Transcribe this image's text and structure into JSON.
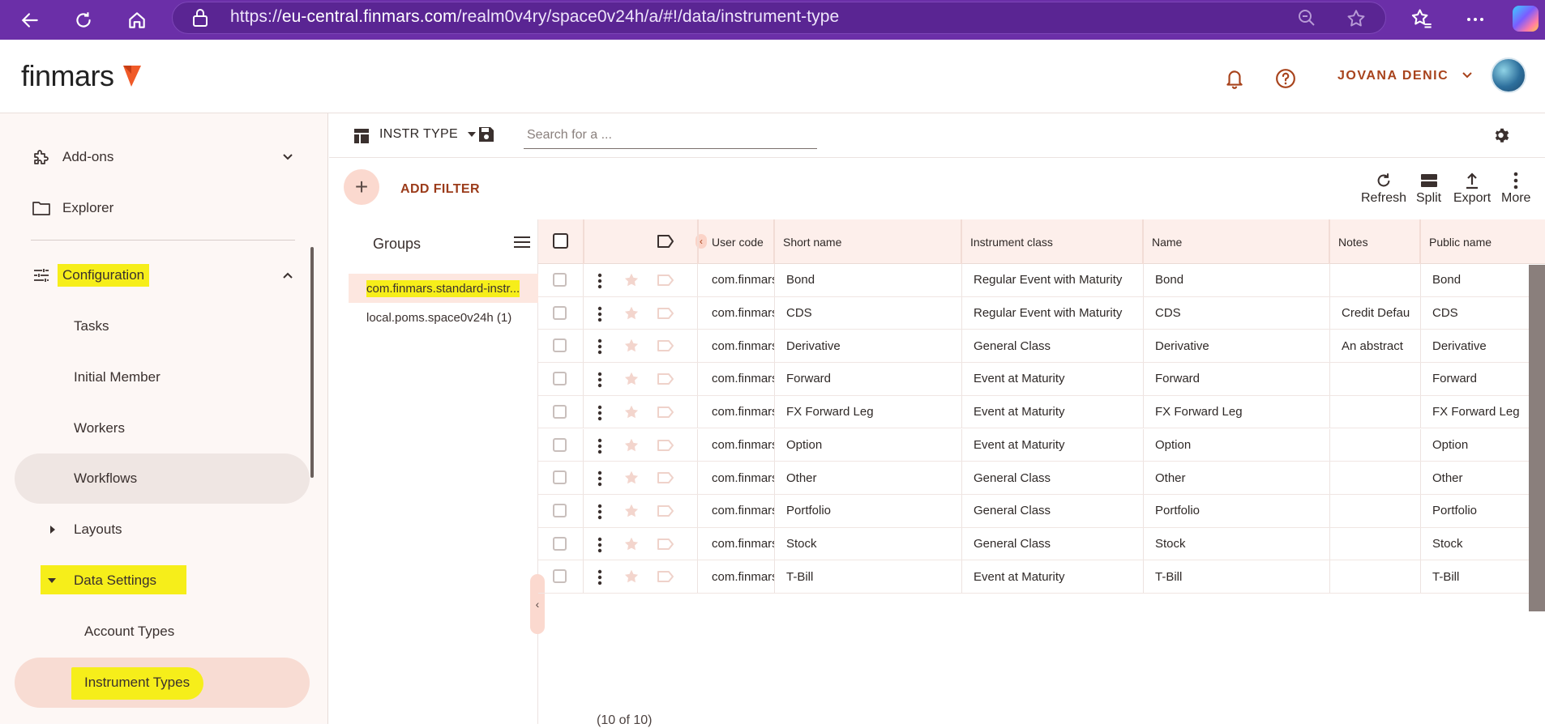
{
  "browser": {
    "url_prefix": "https://",
    "url_host": "eu-central.finmars.com",
    "url_path": "/realm0v4ry/space0v24h/a/#!/data/instrument-type"
  },
  "header": {
    "logo_text": "finmars",
    "user_name": "JOVANA DENIC"
  },
  "sidebar": {
    "addons": "Add-ons",
    "explorer": "Explorer",
    "configuration": "Configuration",
    "tasks": "Tasks",
    "initial_member": "Initial Member",
    "workers": "Workers",
    "workflows": "Workflows",
    "layouts": "Layouts",
    "data_settings": "Data Settings",
    "account_types": "Account Types",
    "instrument_types": "Instrument Types"
  },
  "toolbar": {
    "layout_name": "INSTR TYPE",
    "search_placeholder": "Search for a ...",
    "add_filter": "ADD FILTER",
    "refresh": "Refresh",
    "split": "Split",
    "export": "Export",
    "more": "More"
  },
  "groups": {
    "title": "Groups",
    "items": [
      "com.finmars.standard-instr...",
      "local.poms.space0v24h (1)"
    ]
  },
  "grid": {
    "columns": [
      "User code",
      "Short name",
      "Instrument class",
      "Name",
      "Notes",
      "Public name"
    ],
    "rows": [
      {
        "user_code": "com.finmars",
        "short_name": "Bond",
        "instrument_class": "Regular Event with Maturity",
        "name": "Bond",
        "notes": "",
        "public_name": "Bond"
      },
      {
        "user_code": "com.finmars",
        "short_name": "CDS",
        "instrument_class": "Regular Event with Maturity",
        "name": "CDS",
        "notes": "Credit Defau",
        "public_name": "CDS"
      },
      {
        "user_code": "com.finmars",
        "short_name": "Derivative",
        "instrument_class": "General Class",
        "name": "Derivative",
        "notes": "An abstract",
        "public_name": "Derivative"
      },
      {
        "user_code": "com.finmars",
        "short_name": "Forward",
        "instrument_class": "Event at Maturity",
        "name": "Forward",
        "notes": "",
        "public_name": "Forward"
      },
      {
        "user_code": "com.finmars",
        "short_name": "FX Forward Leg",
        "instrument_class": "Event at Maturity",
        "name": "FX Forward Leg",
        "notes": "",
        "public_name": "FX Forward Leg"
      },
      {
        "user_code": "com.finmars",
        "short_name": "Option",
        "instrument_class": "Event at Maturity",
        "name": "Option",
        "notes": "",
        "public_name": "Option"
      },
      {
        "user_code": "com.finmars",
        "short_name": "Other",
        "instrument_class": "General Class",
        "name": "Other",
        "notes": "",
        "public_name": "Other"
      },
      {
        "user_code": "com.finmars",
        "short_name": "Portfolio",
        "instrument_class": "General Class",
        "name": "Portfolio",
        "notes": "",
        "public_name": "Portfolio"
      },
      {
        "user_code": "com.finmars",
        "short_name": "Stock",
        "instrument_class": "General Class",
        "name": "Stock",
        "notes": "",
        "public_name": "Stock"
      },
      {
        "user_code": "com.finmars",
        "short_name": "T-Bill",
        "instrument_class": "Event at Maturity",
        "name": "T-Bill",
        "notes": "",
        "public_name": "T-Bill"
      }
    ],
    "count_text": "(10 of 10)"
  },
  "colors": {
    "browser_bar": "#6b2fa8",
    "accent": "#a8431c",
    "highlight": "#f6ee1a",
    "sidebar_active": "#f8dcd3"
  }
}
